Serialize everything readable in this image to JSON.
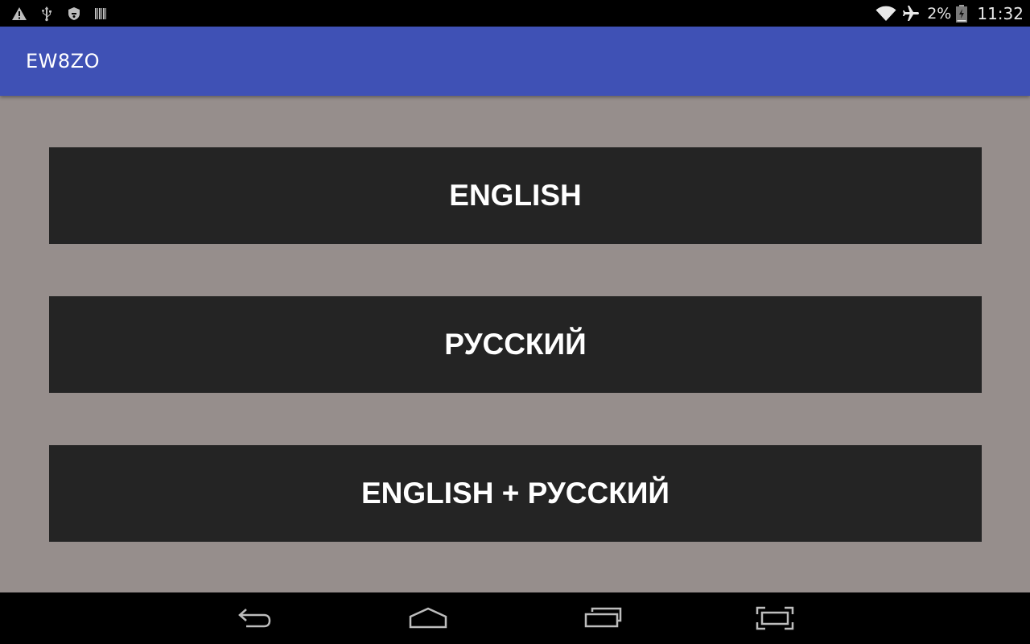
{
  "status_bar": {
    "left_icons": [
      "warning-icon",
      "usb-icon",
      "shield-icon",
      "barcode-icon"
    ],
    "right_icons": [
      "wifi-icon",
      "airplane-mode-icon",
      "battery-icon"
    ],
    "battery_percent": "2%",
    "time": "11:32"
  },
  "app_bar": {
    "title": "EW8ZO",
    "background_color": "#3f51b5"
  },
  "main": {
    "background_color": "#968e8c",
    "buttons": [
      {
        "label": "ENGLISH"
      },
      {
        "label": "РУССКИЙ"
      },
      {
        "label": "ENGLISH + РУССКИЙ"
      }
    ],
    "button_color": "#242424"
  },
  "nav_bar": {
    "buttons": [
      "back-icon",
      "home-icon",
      "recents-icon",
      "screenshot-icon"
    ]
  }
}
